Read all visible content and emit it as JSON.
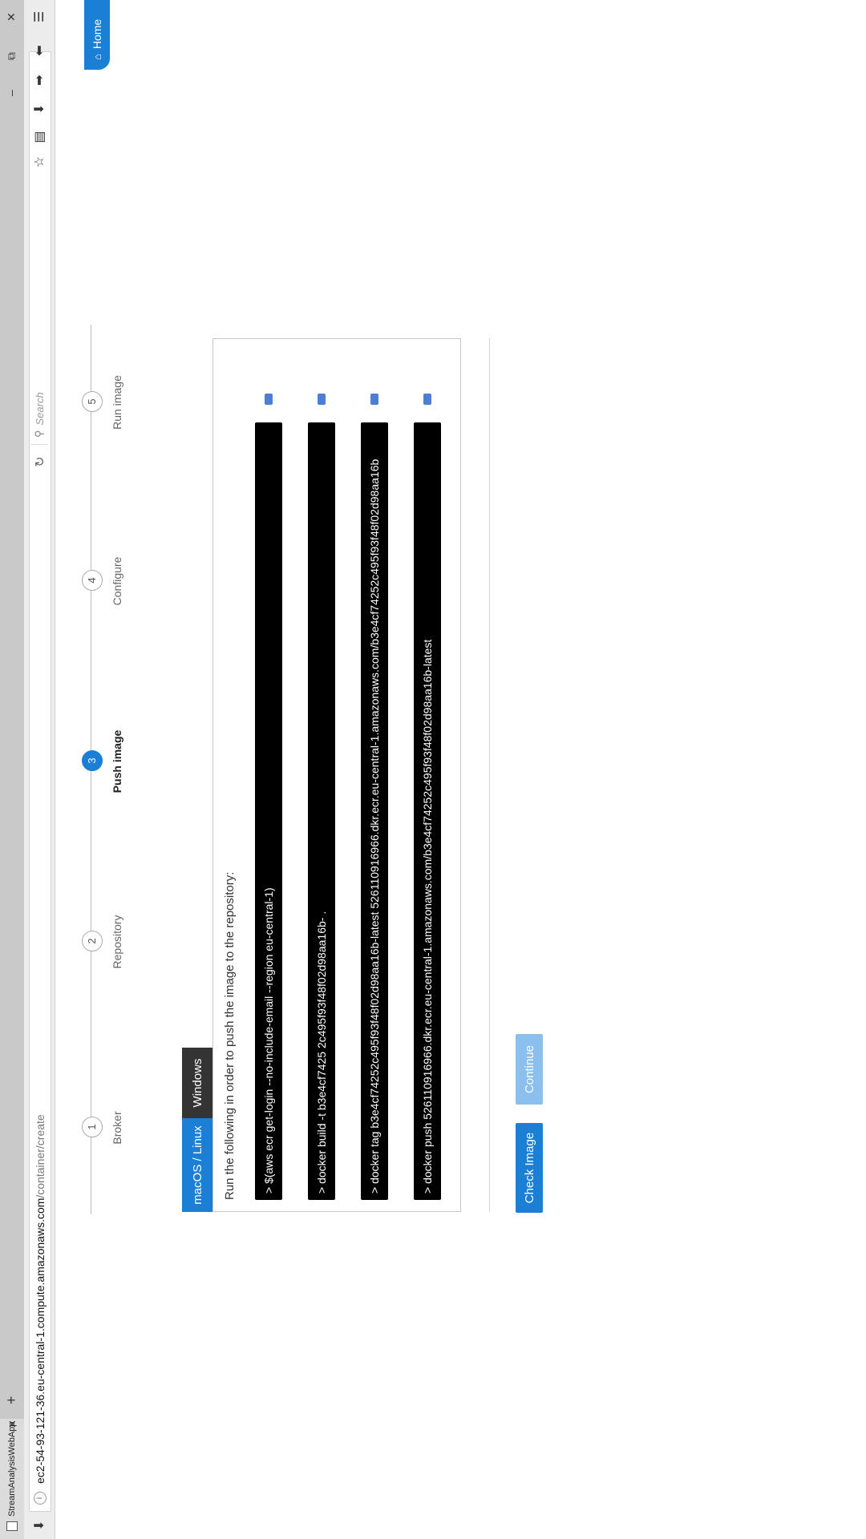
{
  "browser": {
    "tab_title": "StreamAnalysisWebApp",
    "url_host": "ec2-54-93-121-36.eu-central-1.compute.amazonaws.com",
    "url_path": "/container/create",
    "search_placeholder": "Search",
    "info_glyph": "i",
    "reload_glyph": "↻",
    "search_glyph": "⚲",
    "new_tab_glyph": "+",
    "close_glyph": "✕",
    "minimize_glyph": "–",
    "maximize_glyph": "⧉",
    "nav_down_glyph": "⬇",
    "nav_back_glyph": "⬅",
    "nav_forward_glyph": "➡",
    "download_glyph": "⬇",
    "bookmarks_glyph": "▤",
    "star_glyph": "☆",
    "menu_glyph": "☰"
  },
  "header": {
    "home_label": "Home",
    "home_glyph": "⌂"
  },
  "stepper": {
    "steps": [
      {
        "number": "1",
        "label": "Broker"
      },
      {
        "number": "2",
        "label": "Repository"
      },
      {
        "number": "3",
        "label": "Push image"
      },
      {
        "number": "4",
        "label": "Configure"
      },
      {
        "number": "5",
        "label": "Run image"
      }
    ],
    "active_step": 3
  },
  "os_tabs": [
    {
      "label": "macOS / Linux",
      "active": true
    },
    {
      "label": "Windows",
      "active": false
    }
  ],
  "panel": {
    "intro": "Run the following in order to push the image to the repository:",
    "commands": [
      "> $(aws ecr get-login --no-include-email --region eu-central-1)",
      "> docker build -t b3e4cf7425 2c495f93f48f02d98aa16b- .",
      "> docker tag b3e4cf74252c495f93f48f02d98aa16b-latest 526110916966.dkr.ecr.eu-central-1.amazonaws.com/b3e4cf74252c495f93f48f02d98aa16b",
      "> docker push 526110916966.dkr.ecr.eu-central-1.amazonaws.com/b3e4cf74252c495f93f48f02d98aa16b-latest"
    ]
  },
  "actions": {
    "check_label": "Check Image",
    "continue_label": "Continue"
  },
  "colors": {
    "accent": "#1b7fd6",
    "accent_disabled": "#8bbfee",
    "code_bg": "#000000",
    "inactive_tab": "#343434"
  }
}
